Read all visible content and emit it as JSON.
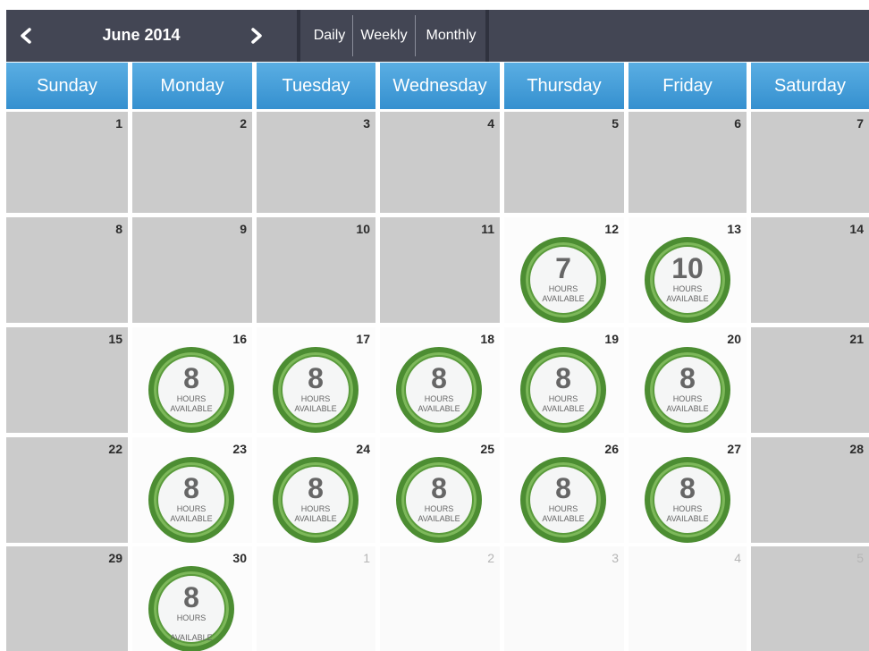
{
  "toolbar": {
    "month_title": "June 2014",
    "prev_icon": "chevron-left-icon",
    "next_icon": "chevron-right-icon",
    "views": [
      "Daily",
      "Weekly",
      "Monthly"
    ]
  },
  "colors": {
    "toolbar_bg": "#434654",
    "header_bg": "#3f9ad6",
    "unavailable_bg": "#cbcbcb",
    "badge_green": "#5a9b3c"
  },
  "weekdays": [
    "Sunday",
    "Monday",
    "Tuesday",
    "Wednesday",
    "Thursday",
    "Friday",
    "Saturday"
  ],
  "hours_label_1": "HOURS",
  "hours_label_2": "AVAILABLE",
  "weeks": [
    [
      {
        "day": "1",
        "state": "closed"
      },
      {
        "day": "2",
        "state": "closed"
      },
      {
        "day": "3",
        "state": "closed"
      },
      {
        "day": "4",
        "state": "closed"
      },
      {
        "day": "5",
        "state": "closed"
      },
      {
        "day": "6",
        "state": "closed"
      },
      {
        "day": "7",
        "state": "closed"
      }
    ],
    [
      {
        "day": "8",
        "state": "closed"
      },
      {
        "day": "9",
        "state": "closed"
      },
      {
        "day": "10",
        "state": "closed"
      },
      {
        "day": "11",
        "state": "closed"
      },
      {
        "day": "12",
        "state": "open",
        "hours": "7"
      },
      {
        "day": "13",
        "state": "open",
        "hours": "10"
      },
      {
        "day": "14",
        "state": "closed"
      }
    ],
    [
      {
        "day": "15",
        "state": "closed"
      },
      {
        "day": "16",
        "state": "open",
        "hours": "8"
      },
      {
        "day": "17",
        "state": "open",
        "hours": "8"
      },
      {
        "day": "18",
        "state": "open",
        "hours": "8"
      },
      {
        "day": "19",
        "state": "open",
        "hours": "8"
      },
      {
        "day": "20",
        "state": "open",
        "hours": "8"
      },
      {
        "day": "21",
        "state": "closed"
      }
    ],
    [
      {
        "day": "22",
        "state": "closed"
      },
      {
        "day": "23",
        "state": "open",
        "hours": "8"
      },
      {
        "day": "24",
        "state": "open",
        "hours": "8"
      },
      {
        "day": "25",
        "state": "open",
        "hours": "8"
      },
      {
        "day": "26",
        "state": "open",
        "hours": "8"
      },
      {
        "day": "27",
        "state": "open",
        "hours": "8"
      },
      {
        "day": "28",
        "state": "closed"
      }
    ],
    [
      {
        "day": "29",
        "state": "closed"
      },
      {
        "day": "30",
        "state": "open",
        "hours": "8"
      },
      {
        "day": "1",
        "state": "other"
      },
      {
        "day": "2",
        "state": "other"
      },
      {
        "day": "3",
        "state": "other"
      },
      {
        "day": "4",
        "state": "other"
      },
      {
        "day": "5",
        "state": "other-closed"
      }
    ]
  ]
}
